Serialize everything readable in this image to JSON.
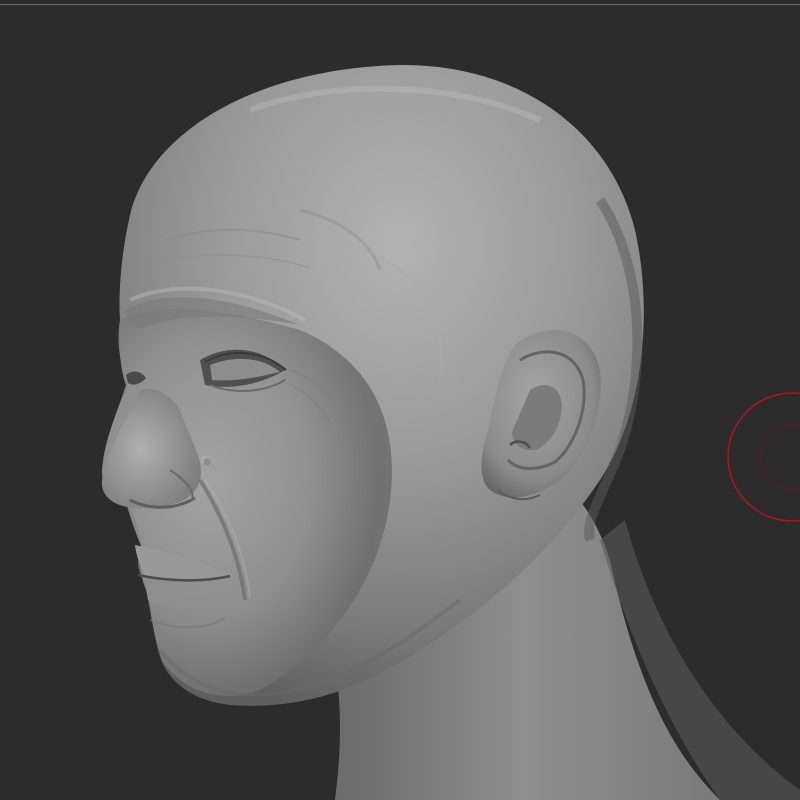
{
  "viewport": {
    "background_color": "#2c2c2c",
    "model_name": "",
    "model_color": "#8a8a8a"
  },
  "brush_cursor": {
    "outer_ring_color": "#b0141c",
    "inner_ring_color": "#5a1a1e"
  },
  "icons": {
    "brush_cursor": "brush-ring-icon"
  }
}
